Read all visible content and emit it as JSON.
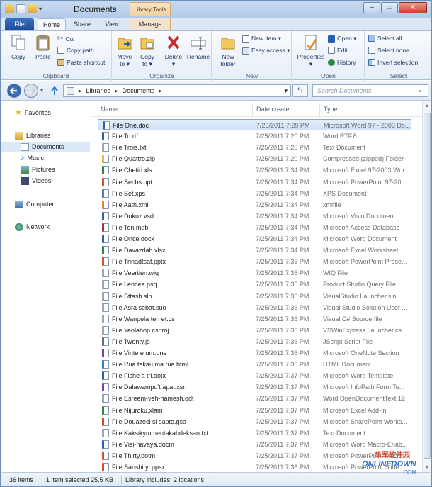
{
  "window": {
    "title": "Documents",
    "context_tab": "Library Tools",
    "controls": [
      "–",
      "▭",
      "✕"
    ]
  },
  "tabs": [
    "File",
    "Home",
    "Share",
    "View",
    "Manage"
  ],
  "ribbon": {
    "clipboard": {
      "label": "Clipboard",
      "copy": "Copy",
      "paste": "Paste",
      "cut": "Cut",
      "copy_path": "Copy path",
      "paste_shortcut": "Paste shortcut"
    },
    "organize": {
      "label": "Organize",
      "move_to_1": "Move",
      "move_to_2": "to ▾",
      "copy_to_1": "Copy",
      "copy_to_2": "to ▾",
      "delete_1": "Delete",
      "delete_2": "▾",
      "rename": "Rename"
    },
    "new": {
      "label": "New",
      "new_folder_1": "New",
      "new_folder_2": "folder",
      "new_item": "New item ▾",
      "easy_access": "Easy access ▾"
    },
    "open": {
      "label": "Open",
      "properties_1": "Properties",
      "properties_2": "▾",
      "open": "Open ▾",
      "edit": "Edit",
      "history": "History"
    },
    "select": {
      "label": "Select",
      "select_all": "Select all",
      "select_none": "Select none",
      "invert": "Invert selection"
    }
  },
  "address": {
    "crumbs": [
      "Libraries",
      "Documents"
    ],
    "search_placeholder": "Search Documents"
  },
  "nav": {
    "favorites": "Favorites",
    "libraries": "Libraries",
    "documents": "Documents",
    "music": "Music",
    "pictures": "Pictures",
    "videos": "Videos",
    "computer": "Computer",
    "network": "Network"
  },
  "columns": {
    "name": "Name",
    "date": "Date created",
    "type": "Type"
  },
  "files": [
    {
      "name": "File One.doc",
      "date": "7/25/2011 7:20 PM",
      "type": "Microsoft Word 97 - 2003 Do...",
      "color": "#2b5fb4"
    },
    {
      "name": "File To.rtf",
      "date": "7/25/2011 7:20 PM",
      "type": "Word.RTF.8",
      "color": "#2b5fb4"
    },
    {
      "name": "File Trois.txt",
      "date": "7/25/2011 7:20 PM",
      "type": "Text Document",
      "color": "#9aa7b8"
    },
    {
      "name": "File Quattro.zip",
      "date": "7/25/2011 7:20 PM",
      "type": "Compressed (zipped) Folder",
      "color": "#e8b84a"
    },
    {
      "name": "File Chetiri.xls",
      "date": "7/25/2011 7:34 PM",
      "type": "Microsoft Excel 97-2003 Wor...",
      "color": "#2e8b3e"
    },
    {
      "name": "File Sechs.ppt",
      "date": "7/25/2011 7:34 PM",
      "type": "Microsoft PowerPoint 97-20...",
      "color": "#d0502a"
    },
    {
      "name": "File Set.xps",
      "date": "7/25/2011 7:34 PM",
      "type": "XPS Document",
      "color": "#3a7fc1"
    },
    {
      "name": "File Aath.xml",
      "date": "7/25/2011 7:34 PM",
      "type": "xmlfile",
      "color": "#d88a2a"
    },
    {
      "name": "File Dokuz.vsd",
      "date": "7/25/2011 7:34 PM",
      "type": "Microsoft Visio Document",
      "color": "#3a5fb0"
    },
    {
      "name": "File Ten.mdb",
      "date": "7/25/2011 7:34 PM",
      "type": "Microsoft Access Database",
      "color": "#a23240"
    },
    {
      "name": "File Once.docx",
      "date": "7/25/2011 7:34 PM",
      "type": "Microsoft Word Document",
      "color": "#2b5fb4"
    },
    {
      "name": "File Davazdah.xlsx",
      "date": "7/25/2011 7:34 PM",
      "type": "Microsoft Excel Worksheet",
      "color": "#2e8b3e"
    },
    {
      "name": "File Trinadtsat.pptx",
      "date": "7/25/2011 7:35 PM",
      "type": "Microsoft PowerPoint Prese...",
      "color": "#d0502a"
    },
    {
      "name": "File Veertien.wiq",
      "date": "7/25/2011 7:35 PM",
      "type": "WIQ File",
      "color": "#9aa7b8"
    },
    {
      "name": "File Lencea.psq",
      "date": "7/25/2011 7:35 PM",
      "type": "Product Studio Query File",
      "color": "#9aa7b8"
    },
    {
      "name": "File Sttash.sln",
      "date": "7/25/2011 7:36 PM",
      "type": "VisualStudio.Launcher.sln",
      "color": "#9aa7b8"
    },
    {
      "name": "File Asra sebat.suo",
      "date": "7/25/2011 7:36 PM",
      "type": "Visual Studio Solution User ...",
      "color": "#9aa7b8"
    },
    {
      "name": "File Wanpela ten et.cs",
      "date": "7/25/2011 7:36 PM",
      "type": "Visual C# Source file",
      "color": "#9aa7b8"
    },
    {
      "name": "File Yeolahop.csproj",
      "date": "7/25/2011 7:36 PM",
      "type": "VSWinExpress.Launcher.cspr...",
      "color": "#9aa7b8"
    },
    {
      "name": "File Twenty.js",
      "date": "7/25/2011 7:36 PM",
      "type": "JScript Script File",
      "color": "#6a6a6a"
    },
    {
      "name": "File Vinte e um.one",
      "date": "7/25/2011 7:36 PM",
      "type": "Microsoft OneNote Section",
      "color": "#7a3fa0"
    },
    {
      "name": "File Rua tekau ma rua.html",
      "date": "7/25/2011 7:36 PM",
      "type": "HTML Document",
      "color": "#3a7fc1"
    },
    {
      "name": "File Fiche a tri.dotx",
      "date": "7/25/2011 7:37 PM",
      "type": "Microsoft Word Template",
      "color": "#2b5fb4"
    },
    {
      "name": "File Dalawampu't apat.xsn",
      "date": "7/25/2011 7:37 PM",
      "type": "Microsoft InfoPath Form Te...",
      "color": "#7a3fa0"
    },
    {
      "name": "File Esreem-veh-hamesh.odt",
      "date": "7/25/2011 7:37 PM",
      "type": "Word.OpenDocumentText.12",
      "color": "#9aa7b8"
    },
    {
      "name": "File Nijuroku.xlam",
      "date": "7/25/2011 7:37 PM",
      "type": "Microsoft Excel Add-In",
      "color": "#2e8b3e"
    },
    {
      "name": "File Douazeci si sapte.gsa",
      "date": "7/25/2011 7:37 PM",
      "type": "Microsoft SharePoint Works...",
      "color": "#d0502a"
    },
    {
      "name": "File Kaksikymmentakahdeksan.txt",
      "date": "7/25/2011 7:37 PM",
      "type": "Text Document",
      "color": "#9aa7b8"
    },
    {
      "name": "File Visi-navaya.docm",
      "date": "7/25/2011 7:37 PM",
      "type": "Microsoft Word Macro-Enab...",
      "color": "#2b5fb4"
    },
    {
      "name": "File Thirty.potm",
      "date": "7/25/2011 7:37 PM",
      "type": "Microsoft PowerPoint Macr...",
      "color": "#d0502a"
    },
    {
      "name": "File Sanshi yi.ppsx",
      "date": "7/25/2011 7:38 PM",
      "type": "Microsoft PowerPoint Slide ...",
      "color": "#d0502a"
    }
  ],
  "status": {
    "items": "36 items",
    "selected": "1 item selected  25.5 KB",
    "library": "Library includes: 2 locations"
  },
  "watermark": {
    "line1": "华军软件园",
    "line2": "ONLINEDOWN",
    "line3": ".COM"
  }
}
